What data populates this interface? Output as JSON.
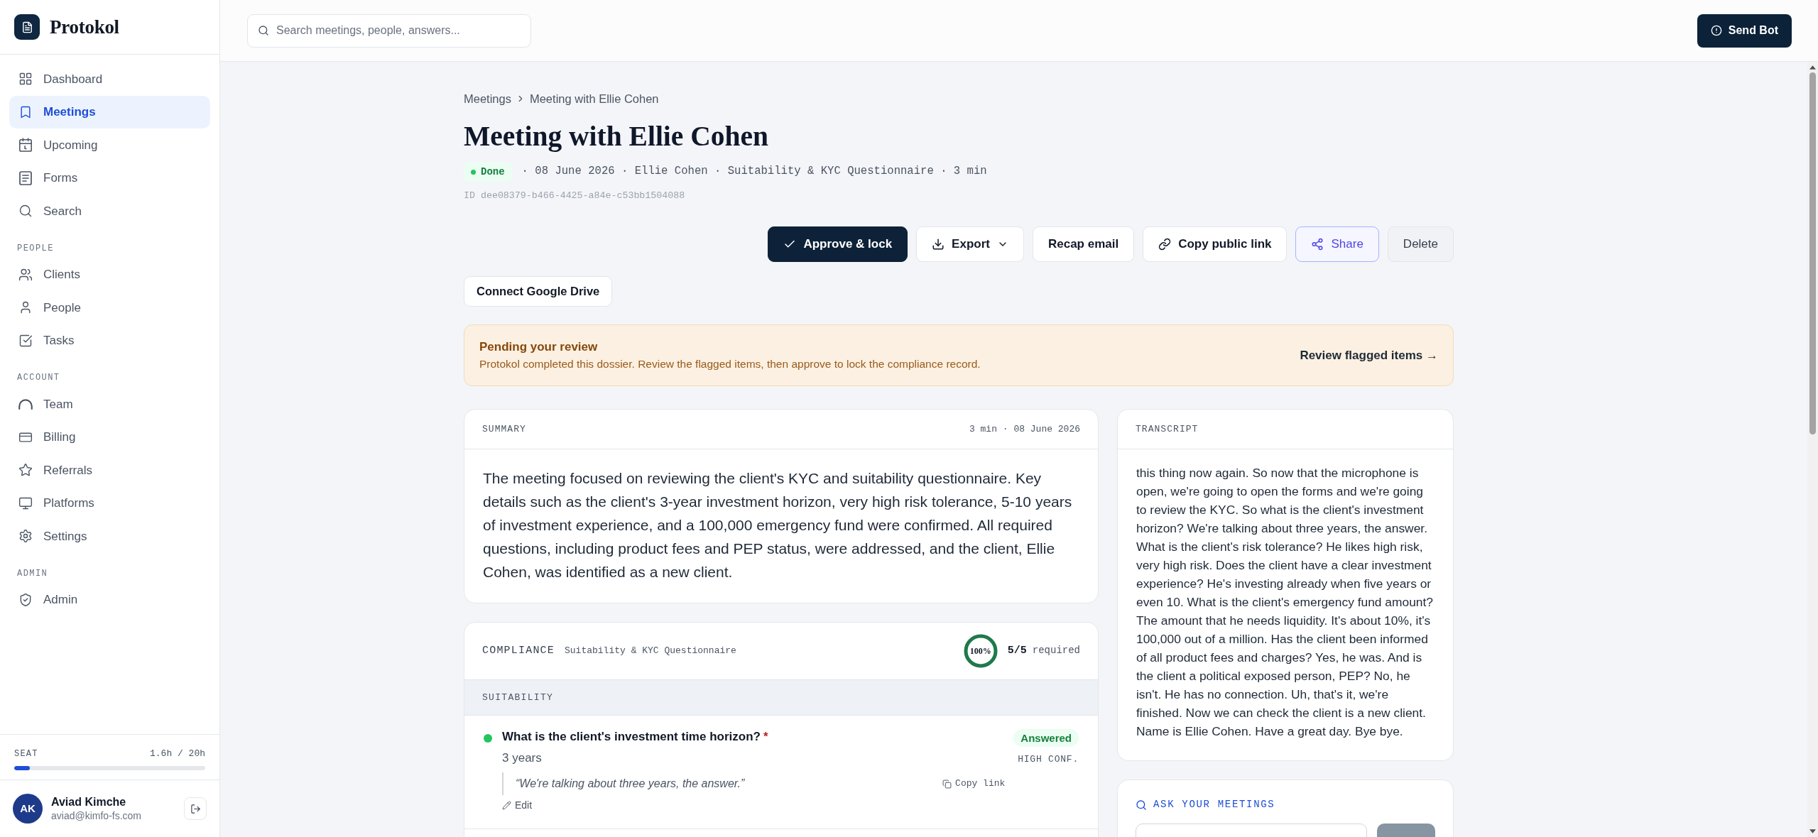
{
  "app": {
    "name": "Protokol"
  },
  "sidebar": {
    "sections": [
      {
        "items": [
          {
            "label": "Dashboard",
            "selected": false
          },
          {
            "label": "Meetings",
            "selected": true
          },
          {
            "label": "Upcoming",
            "selected": false
          },
          {
            "label": "Forms",
            "selected": false
          },
          {
            "label": "Search",
            "selected": false
          }
        ]
      },
      {
        "heading": "PEOPLE",
        "items": [
          {
            "label": "Clients",
            "selected": false
          },
          {
            "label": "People",
            "selected": false
          },
          {
            "label": "Tasks",
            "selected": false
          }
        ]
      },
      {
        "heading": "ACCOUNT",
        "items": [
          {
            "label": "Team",
            "selected": false
          },
          {
            "label": "Billing",
            "selected": false
          },
          {
            "label": "Referrals",
            "selected": false
          },
          {
            "label": "Platforms",
            "selected": false
          },
          {
            "label": "Settings",
            "selected": false
          }
        ]
      },
      {
        "heading": "ADMIN",
        "items": [
          {
            "label": "Admin",
            "selected": false
          }
        ]
      }
    ],
    "seat": {
      "label": "SEAT",
      "reading": "1.6h / 20h",
      "level": 0.08
    },
    "user": {
      "initials": "AK",
      "name": "Aviad Kimche",
      "email": "aviad@kimfo-fs.com"
    }
  },
  "topbar": {
    "search": {
      "placeholder": "Search meetings, people, answers..."
    },
    "send_button": "Send Bot"
  },
  "breadcrumb": [
    "Meetings",
    "Meeting with Ellie Cohen"
  ],
  "title": "Meeting with Ellie Cohen",
  "meta": {
    "status": "Done",
    "details": "· 08 June 2026 · Ellie Cohen · Suitability & KYC Questionnaire · 3 min",
    "id": "ID dee08379-b466-4425-a84e-c53bb1504088"
  },
  "actions": [
    {
      "label": "Approve & lock",
      "kind": "primary"
    },
    {
      "label": "Export",
      "kind": "menu"
    },
    {
      "label": "Recap email",
      "kind": "default"
    },
    {
      "label": "Copy public link",
      "kind": "default"
    },
    {
      "label": "Share",
      "kind": "accent"
    },
    {
      "label": "Delete",
      "kind": "muted"
    }
  ],
  "drive_button": "Connect Google Drive",
  "banner": {
    "title": "Pending your review",
    "text": "Protokol completed this dossier. Review the flagged items, then approve to lock the compliance record.",
    "link": "Review flagged items →"
  },
  "summary": {
    "heading": "SUMMARY",
    "meta": "3 min · 08 June 2026",
    "text": "The meeting focused on reviewing the client's KYC and suitability questionnaire. Key details such as the client's 3-year investment horizon, very high risk tolerance, 5-10 years of investment experience, and a 100,000 emergency fund were confirmed. All required questions, including product fees and PEP status, were addressed, and the client, Ellie Cohen, was identified as a new client."
  },
  "compliance": {
    "heading": "COMPLIANCE",
    "form": "Suitability & KYC Questionnaire",
    "progress": {
      "label": "100%",
      "level": 1
    },
    "count": "5/5",
    "count_label": "required",
    "sections": [
      {
        "heading": "SUITABILITY",
        "questions": [
          {
            "question": "What is the client's investment time horizon?",
            "required_mark": "*",
            "color": "#22c55e",
            "status": "Answered",
            "confidence": "HIGH CONF.",
            "answer": "3 years",
            "quote": "“We're talking about three years, the answer.”",
            "copy": "Copy link",
            "edit": "Edit"
          }
        ]
      }
    ]
  },
  "transcript": {
    "heading": "TRANSCRIPT",
    "text": "this thing now again. So now that the microphone is open, we're going to open the forms and we're going to review the KYC. So what is the client's investment horizon? We're talking about three years, the answer. What is the client's risk tolerance? He likes high risk, very high risk. Does the client have a clear investment experience? He's investing already when five years or even 10. What is the client's emergency fund amount? The amount that he needs liquidity. It's about 10%, it's 100,000 out of a million. Has the client been informed of all product fees and charges? Yes, he was. And is the client a political exposed person, PEP? No, he isn't. He has no connection. Uh, that's it, we're finished. Now we can check the client is a new client. Name is Ellie Cohen. Have a great day. Bye bye."
  },
  "ask": {
    "heading": "ASK YOUR MEETINGS"
  }
}
